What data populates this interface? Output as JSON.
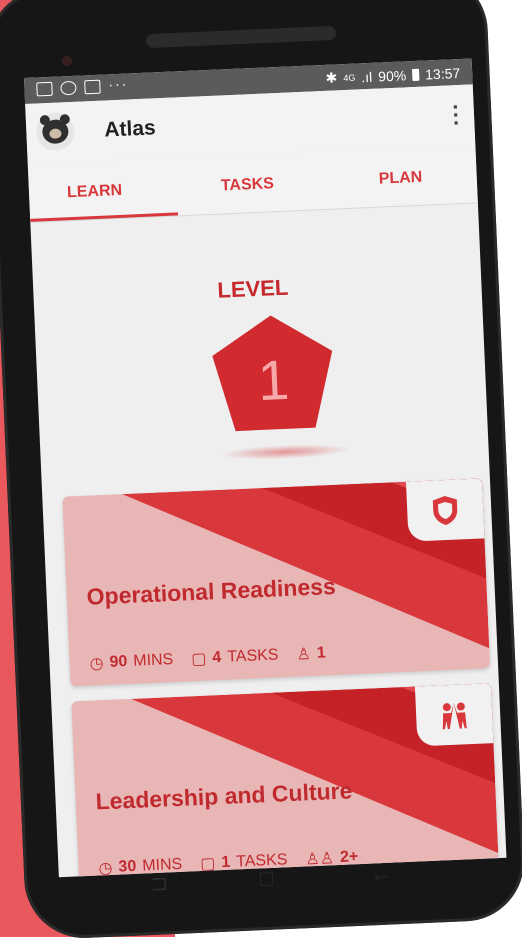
{
  "status": {
    "time": "13:57",
    "battery": "90%",
    "network": "4G",
    "dots": "···"
  },
  "app": {
    "title": "Atlas"
  },
  "tabs": [
    {
      "label": "LEARN"
    },
    {
      "label": "TASKS"
    },
    {
      "label": "PLAN"
    }
  ],
  "level": {
    "label": "LEVEL",
    "value": "1"
  },
  "cards": [
    {
      "title": "Operational Readiness",
      "mins_value": "90",
      "mins_unit": "MINS",
      "tasks_value": "4",
      "tasks_unit": "TASKS",
      "people": "1",
      "icon": "shield-icon"
    },
    {
      "title": "Leadership and Culture",
      "mins_value": "30",
      "mins_unit": "MINS",
      "tasks_value": "1",
      "tasks_unit": "TASKS",
      "people": "2+",
      "icon": "high-five-icon"
    }
  ],
  "colors": {
    "accent": "#d8373b",
    "background_panel": "#e8585d",
    "card_light": "#e8b6b4"
  }
}
